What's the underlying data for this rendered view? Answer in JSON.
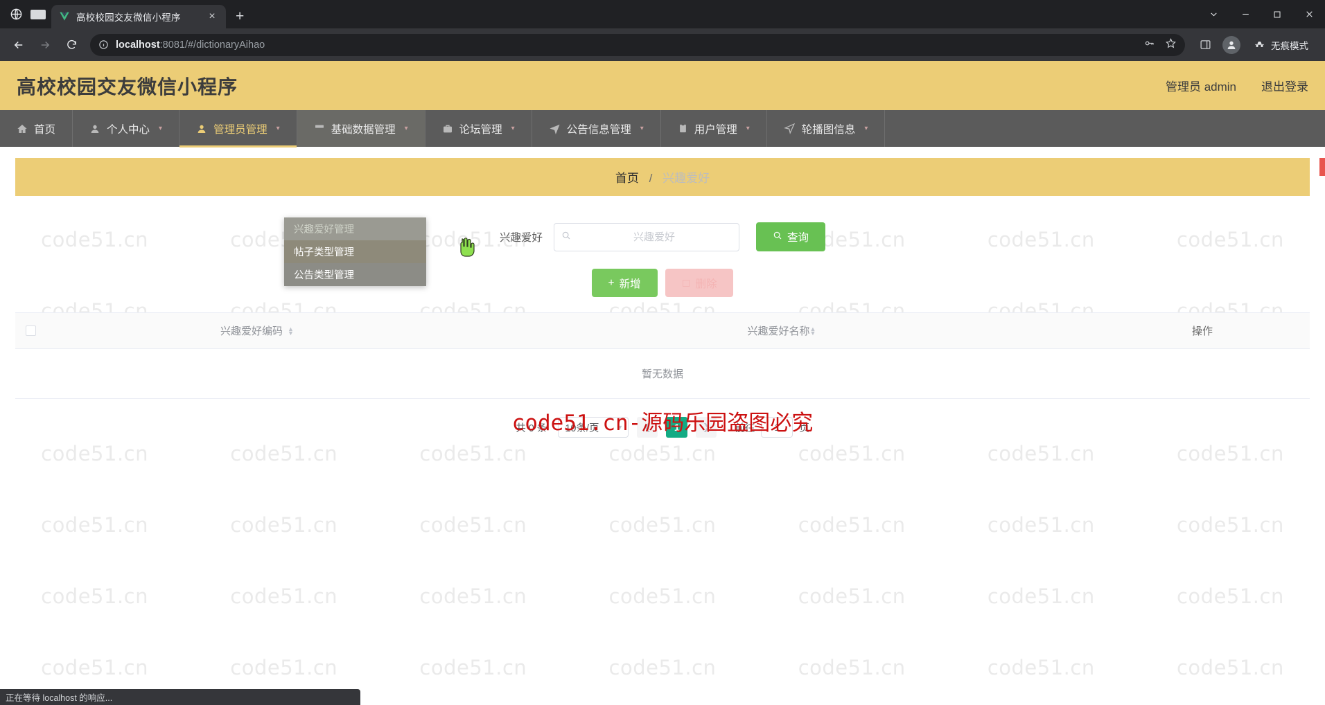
{
  "browser": {
    "tab": {
      "title": "高校校园交友微信小程序",
      "favicon": "vue-logo-icon",
      "close": "×"
    },
    "newtab_label": "+",
    "window_controls": [
      "chevron-down",
      "minimize",
      "maximize",
      "close"
    ],
    "url": {
      "scheme_host": "localhost",
      "rest": ":8081/#/dictionaryAihao"
    },
    "incognito_label": "无痕模式",
    "profile_initial": "",
    "status_text": "正在等待 localhost 的响应..."
  },
  "app": {
    "title": "高校校园交友微信小程序",
    "user_label": "管理员 admin",
    "logout_label": "退出登录"
  },
  "nav": {
    "items": [
      {
        "label": "首页",
        "icon": "home-icon",
        "caret": false,
        "active": false
      },
      {
        "label": "个人中心",
        "icon": "user-icon",
        "caret": true,
        "active": false
      },
      {
        "label": "管理员管理",
        "icon": "user-admin-icon",
        "caret": true,
        "active": true
      },
      {
        "label": "基础数据管理",
        "icon": "database-icon",
        "caret": true,
        "active": false
      },
      {
        "label": "论坛管理",
        "icon": "briefcase-icon",
        "caret": true,
        "active": false
      },
      {
        "label": "公告信息管理",
        "icon": "send-icon",
        "caret": true,
        "active": false
      },
      {
        "label": "用户管理",
        "icon": "clipboard-icon",
        "caret": true,
        "active": false
      },
      {
        "label": "轮播图信息",
        "icon": "navigation-icon",
        "caret": true,
        "active": false
      }
    ]
  },
  "dropdown": {
    "items": [
      {
        "label": "兴趣爱好管理",
        "state": "faded"
      },
      {
        "label": "帖子类型管理",
        "state": "hover"
      },
      {
        "label": "公告类型管理",
        "state": "normal"
      }
    ]
  },
  "breadcrumb": {
    "root": "首页",
    "separator": "/",
    "current": "兴趣爱好"
  },
  "search": {
    "label": "兴趣爱好",
    "placeholder": "兴趣爱好",
    "value": "",
    "button_label": "查询",
    "button_icon": "search-icon"
  },
  "actions": {
    "add_label": "新增",
    "add_icon": "plus-icon",
    "delete_label": "删除",
    "delete_icon": "trash-icon"
  },
  "table": {
    "columns": [
      {
        "key": "check",
        "label": ""
      },
      {
        "key": "code",
        "label": "兴趣爱好编码",
        "sortable": true
      },
      {
        "key": "name",
        "label": "兴趣爱好名称",
        "sortable": true
      },
      {
        "key": "op",
        "label": "操作",
        "sortable": false
      }
    ],
    "rows": [],
    "empty_text": "暂无数据"
  },
  "pagination": {
    "total_text": "共 0 条",
    "page_size_label": "10条/页",
    "prev_icon": "chevron-left-icon",
    "next_icon": "chevron-right-icon",
    "current_page": "1",
    "jump_prefix": "前往",
    "jump_value": "1",
    "jump_suffix": "页"
  },
  "watermark": {
    "tile_text": "code51.cn",
    "center_text": "code51.cn-源码乐园盗图必究"
  },
  "colors": {
    "brand_gold": "#eccd76",
    "nav_dark": "#5b5b5b",
    "green_primary": "#68c153",
    "green_add": "#79c95e",
    "pink_disabled": "#f6c5c5",
    "pager_active": "#13ab84",
    "red_watermark": "#cc1111"
  }
}
